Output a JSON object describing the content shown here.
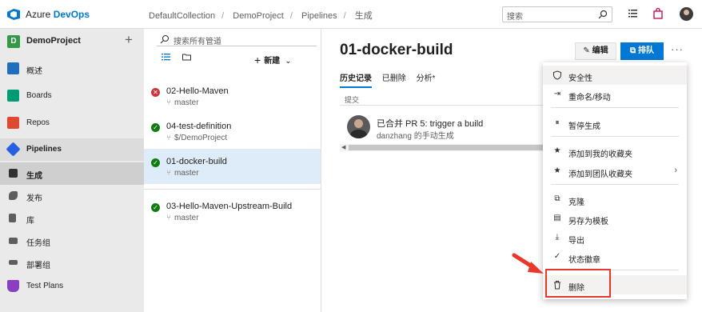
{
  "topbar": {
    "brand_prefix": "Azure ",
    "brand_name": "DevOps",
    "breadcrumb": [
      "DefaultCollection",
      "DemoProject",
      "Pipelines",
      "生成"
    ],
    "search_placeholder": "搜索"
  },
  "project": {
    "initial": "D",
    "name": "DemoProject",
    "add_symbol": "+"
  },
  "nav": {
    "overview": "概述",
    "boards": "Boards",
    "repos": "Repos",
    "pipelines": "Pipelines",
    "builds": "生成",
    "releases": "发布",
    "library": "库",
    "task_groups": "任务组",
    "deployment_groups": "部署组",
    "test_plans": "Test Plans"
  },
  "definitions": {
    "search_placeholder": "搜索所有管道",
    "new_label": "新建",
    "items": [
      {
        "name": "02-Hello-Maven",
        "branch": "master",
        "status": "failed"
      },
      {
        "name": "04-test-definition",
        "branch": "$/DemoProject",
        "status": "succeeded"
      },
      {
        "name": "01-docker-build",
        "branch": "master",
        "status": "succeeded"
      },
      {
        "name": "03-Hello-Maven-Upstream-Build",
        "branch": "master",
        "status": "succeeded"
      }
    ]
  },
  "main": {
    "title": "01-docker-build",
    "edit_label": "编辑",
    "queue_label": "排队",
    "more_label": "···",
    "tabs": [
      "历史记录",
      "已删除",
      "分析*"
    ],
    "column_header": "提交",
    "run": {
      "title": "已合并 PR 5: trigger a build",
      "subtitle": "danzhang 的手动生成"
    }
  },
  "menu": {
    "security": "安全性",
    "rename": "重命名/移动",
    "pause": "暂停生成",
    "add_favorites": "添加到我的收藏夹",
    "add_team_favorites": "添加到团队收藏夹",
    "clone": "克隆",
    "save_template": "另存为模板",
    "export": "导出",
    "status_badge": "状态徽章",
    "delete": "删除"
  },
  "colors": {
    "accent": "#0078d4",
    "success": "#107c10",
    "failure": "#d13438",
    "highlight_box": "#e8382c"
  }
}
